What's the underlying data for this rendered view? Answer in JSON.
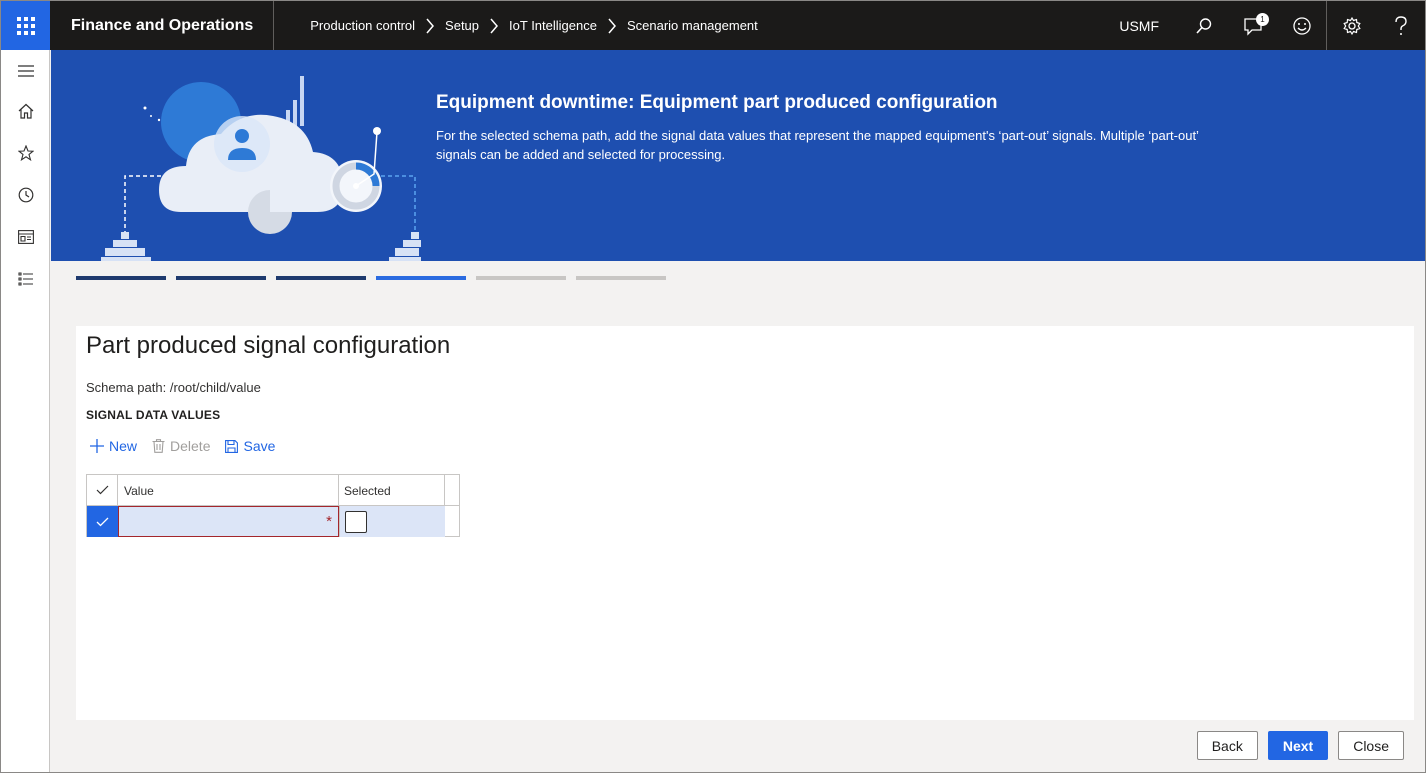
{
  "header": {
    "app_title": "Finance and Operations",
    "breadcrumb": [
      "Production control",
      "Setup",
      "IoT Intelligence",
      "Scenario management"
    ],
    "company": "USMF",
    "notification_count": "1"
  },
  "banner": {
    "title": "Equipment downtime: Equipment part produced configuration",
    "description": "For the selected schema path, add the signal data values that represent the mapped equipment's ‘part-out’ signals. Multiple ‘part-out’ signals can be added and selected for processing."
  },
  "steps": {
    "total": 6,
    "completed": 3,
    "current": 4
  },
  "page": {
    "heading": "Part produced signal configuration",
    "schema_path": "Schema path: /root/child/value",
    "section_label": "SIGNAL DATA VALUES"
  },
  "toolbar": {
    "new_label": "New",
    "delete_label": "Delete",
    "save_label": "Save"
  },
  "grid": {
    "columns": [
      "Value",
      "Selected"
    ],
    "rows": [
      {
        "value": "",
        "selected": false,
        "required_marker": "*"
      }
    ]
  },
  "footer": {
    "back_label": "Back",
    "next_label": "Next",
    "close_label": "Close"
  },
  "colors": {
    "accent": "#2266e3",
    "banner": "#1e4fb0",
    "topbar": "#1b1a19",
    "error": "#a4262c"
  }
}
